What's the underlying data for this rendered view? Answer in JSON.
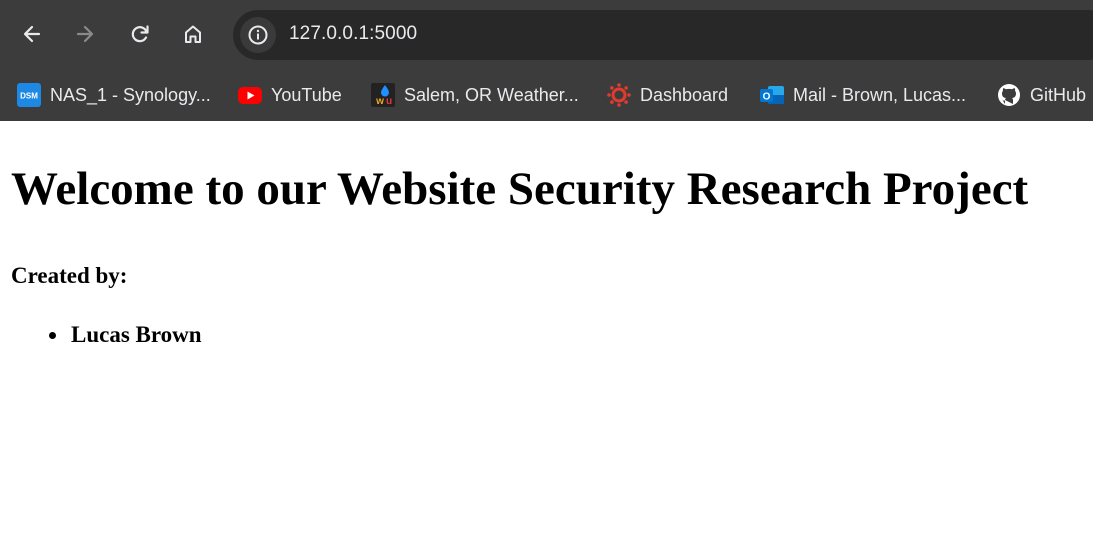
{
  "browser": {
    "url": "127.0.0.1:5000",
    "bookmarks": [
      {
        "label": "NAS_1 - Synology...",
        "icon": "dsm-icon"
      },
      {
        "label": "YouTube",
        "icon": "youtube-icon"
      },
      {
        "label": "Salem, OR Weather...",
        "icon": "wunderground-icon"
      },
      {
        "label": "Dashboard",
        "icon": "canvas-icon"
      },
      {
        "label": "Mail - Brown, Lucas...",
        "icon": "outlook-icon"
      },
      {
        "label": "GitHub",
        "icon": "github-icon"
      }
    ],
    "colors": {
      "chrome": "#3c3c3c",
      "omnibox": "#282828",
      "text": "#e8eaed"
    }
  },
  "page": {
    "title": "Welcome to our Website Security Research Project",
    "created_by": "Created by:",
    "authors": [
      "Lucas Brown"
    ]
  }
}
